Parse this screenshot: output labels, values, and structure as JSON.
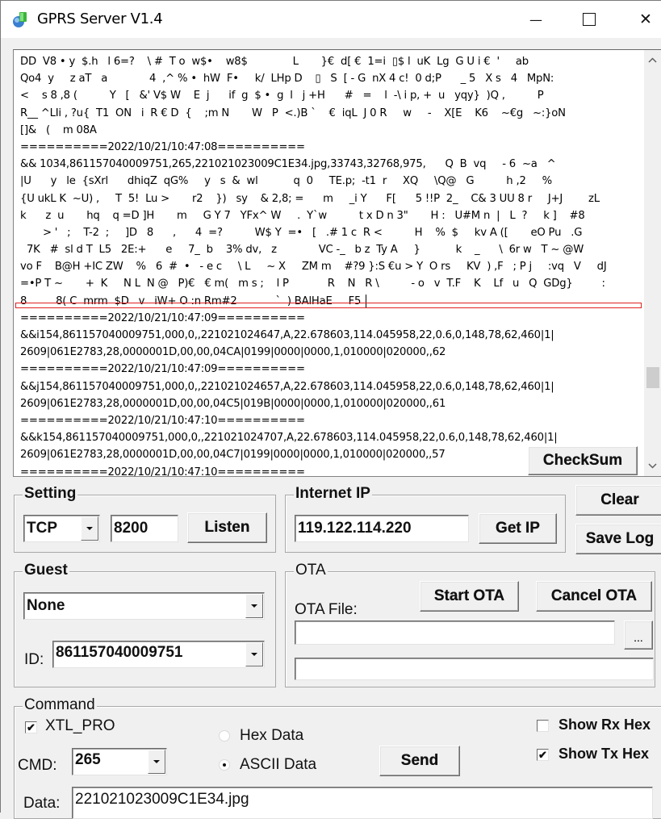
{
  "window": {
    "title": "GPRS Server V1.4",
    "minimize_glyph": "—",
    "maximize_glyph": "☐",
    "close_glyph": "✕"
  },
  "log": {
    "lines": [
      "DD  V8 • y  $.h   l 6=?    \\ #  T o  w$•    w8$              L       }€  d[ €  1=i  ▯$ l  uK  Lg  G U i €  '     ab",
      "Qo4  y     z aT   a             4  ,^ % •  hW  F•     k/  LHp D    ▯   S  [ - G  nX 4 c!  0 d;P      _ 5   X s   4   MpN:",
      "<    s 8 ,8 (          Y   [   &' V$ W    E  j      if  g  $ •  g  l   j +H      #   =    l  -\\ i p, +  u   yqy}  )Q ,          P",
      "R__ ^LIi , ?u{  T1  ON   i  R € D  {    ;m N       W   P  <.)B `    €  iqL  J 0 R     w     -    X[E    K6    ~€g   ~:}oN",
      "[]&   (    m 08A",
      "==========2022/10/21/10:47:08==========",
      "&& 1034,861157040009751,265,221021023009C1E34.jpg,33743,32768,975,      Q  B  vq     - 6  ~a   ^",
      "|U      y   le  {sXrl      dhiqZ  qG%     y   s  &  wl           q  0     TE.p;  -t1  r     XQ     \\Q@   G          h ,2     %",
      "{U ukL K  ~U) ,     T  5!  Lu >       r2    })   sy    & 2,8; =      m     _i Y      F[      5 !!P  2_    C& 3 UU 8 r     J+J        zL",
      "k      z  u       hq    q =D ]H       m     G Y 7   YFx^ W     .  Y`w          t x D n 3\"       H :   U#M n  |   L  ?     k ]    #8",
      "       > '   ;    T-2  ;     ]D   8      ,      4  =?          W$ Y  =•   [   .# 1 c  R <          H    %  $     kv A ([       eO Pu   .G",
      "  7K   #  sl d T  L5   2E:+      e     7_  b    3% dv,   z             VC -_   b z  Ty A     }           k    _      \\  6r w   T ~ @W",
      "vo F    B@H +IC ZW    %   6  #  •   - e c     \\ L     ~ X     ZM m    #?9 }:S €u > Y  O rs     KV  ) ,F   ; P j     :vq   V     dJ",
      "=•P T ~       +  K     N L  N @   P)€   € m(   m s ;    l P            R    N   R \\          - o   v  T.F    K    Lf   u   Q  GDg}         :",
      "8         8( C  mrm  $D   v   iW+ O :n Rm#2            `  ) BAlHaE     F5 ",
      "==========2022/10/21/10:47:09==========",
      "&&i154,861157040009751,000,0,,221021024647,A,22.678603,114.045958,22,0.6,0,148,78,62,460|1|",
      "2609|061E2783,28,0000001D,00,00,04CA|0199|0000|0000,1,010000|020000,,62",
      "==========2022/10/21/10:47:09==========",
      "&&j154,861157040009751,000,0,,221021024657,A,22.678603,114.045958,22,0.6,0,148,78,62,460|1|",
      "2609|061E2783,28,0000001D,00,00,04C5|019B|0000|0000,1,010000|020000,,61",
      "==========2022/10/21/10:47:10==========",
      "&&k154,861157040009751,000,0,,221021024707,A,22.678603,114.045958,22,0.6,0,148,78,62,460|1|",
      "2609|061E2783,28,0000001D,00,00,04C7|0199|0000|0000,1,010000|020000,,57",
      "==========2022/10/21/10:47:10=========="
    ],
    "scroll_up_glyph": "^",
    "scroll_down_glyph": "v"
  },
  "checksum_button": "CheckSum",
  "setting": {
    "label": "Setting",
    "protocol": "TCP",
    "port": "8200",
    "listen_button": "Listen"
  },
  "internet_ip": {
    "label": "Internet IP",
    "ip": "119.122.114.220",
    "get_ip_button": "Get IP"
  },
  "clear_button": "Clear",
  "save_log_button": "Save Log",
  "guest": {
    "label": "Guest",
    "selected": "None",
    "id_label": "ID:",
    "id_value": "861157040009751"
  },
  "ota": {
    "label": "OTA",
    "start_button": "Start OTA",
    "cancel_button": "Cancel OTA",
    "file_label": "OTA File:",
    "file_value": "",
    "browse_button": "...",
    "status_value": ""
  },
  "command": {
    "label": "Command",
    "xtl_pro_label": "XTL_PRO",
    "xtl_pro_checked": true,
    "hex_data_label": "Hex Data",
    "ascii_data_label": "ASCII Data",
    "data_mode": "ASCII Data",
    "cmd_label": "CMD:",
    "cmd_value": "265",
    "send_button": "Send",
    "show_rx_hex_label": "Show Rx Hex",
    "show_rx_hex_checked": false,
    "show_tx_hex_label": "Show Tx Hex",
    "show_tx_hex_checked": true,
    "data_label": "Data:",
    "data_value": "221021023009C1E34.jpg",
    "check_glyph": "✔"
  }
}
